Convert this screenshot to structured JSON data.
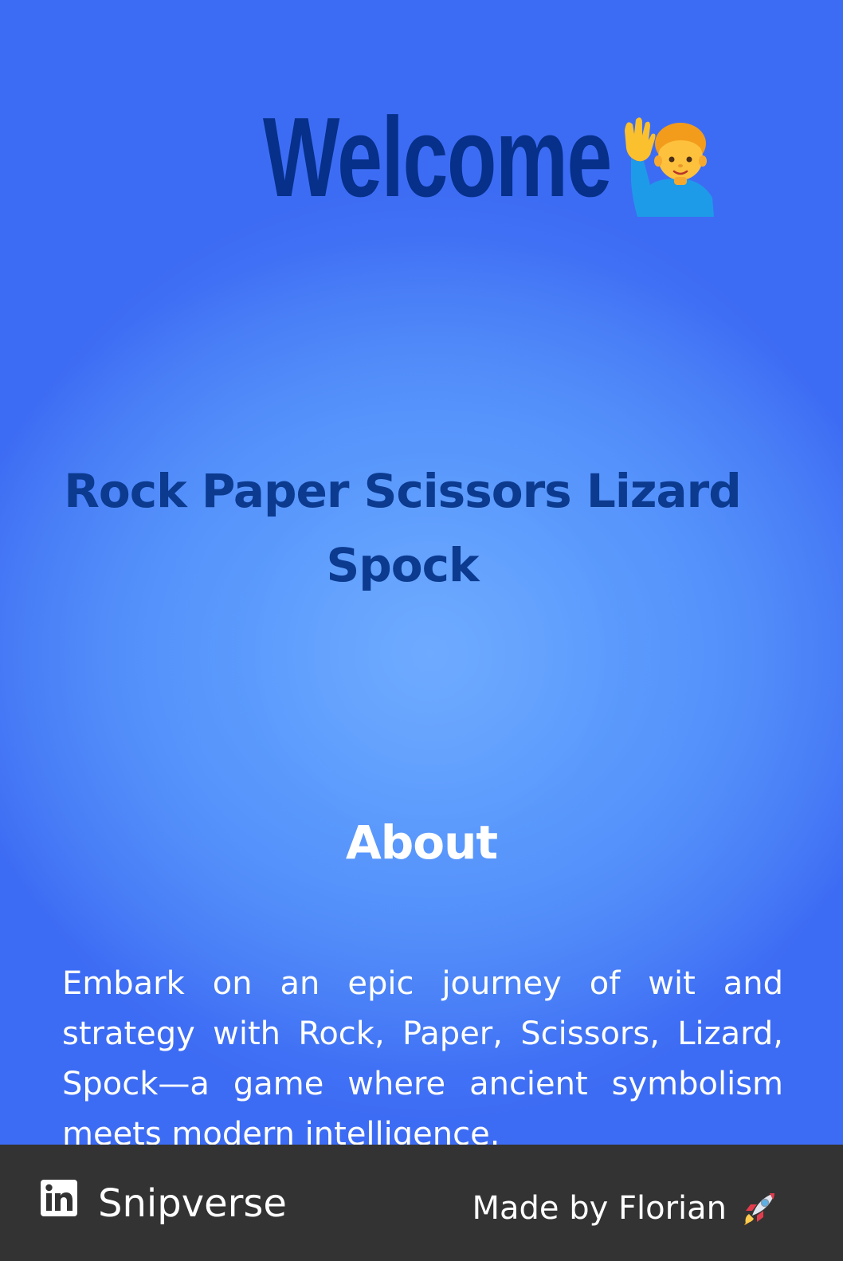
{
  "hero": {
    "welcome": "Welcome",
    "wave_emoji": "person-raising-hand-icon"
  },
  "game": {
    "title": "Rock Paper Scissors Lizard Spock"
  },
  "about": {
    "heading": "About",
    "text": "Embark on an epic journey of wit and strategy with Rock, Paper, Scissors, Lizard, Spock—a game where ancient symbolism meets modern intelligence."
  },
  "footer": {
    "brand": "Snipverse",
    "brand_icon": "linkedin-icon",
    "made_by": "Made by Florian",
    "made_by_icon": "rocket-icon",
    "background": "#333333"
  },
  "colors": {
    "welcome": "#06308a",
    "title": "#0b3a8f",
    "background_center": "#6aa8ff",
    "background_edge": "#3d6cf4"
  }
}
